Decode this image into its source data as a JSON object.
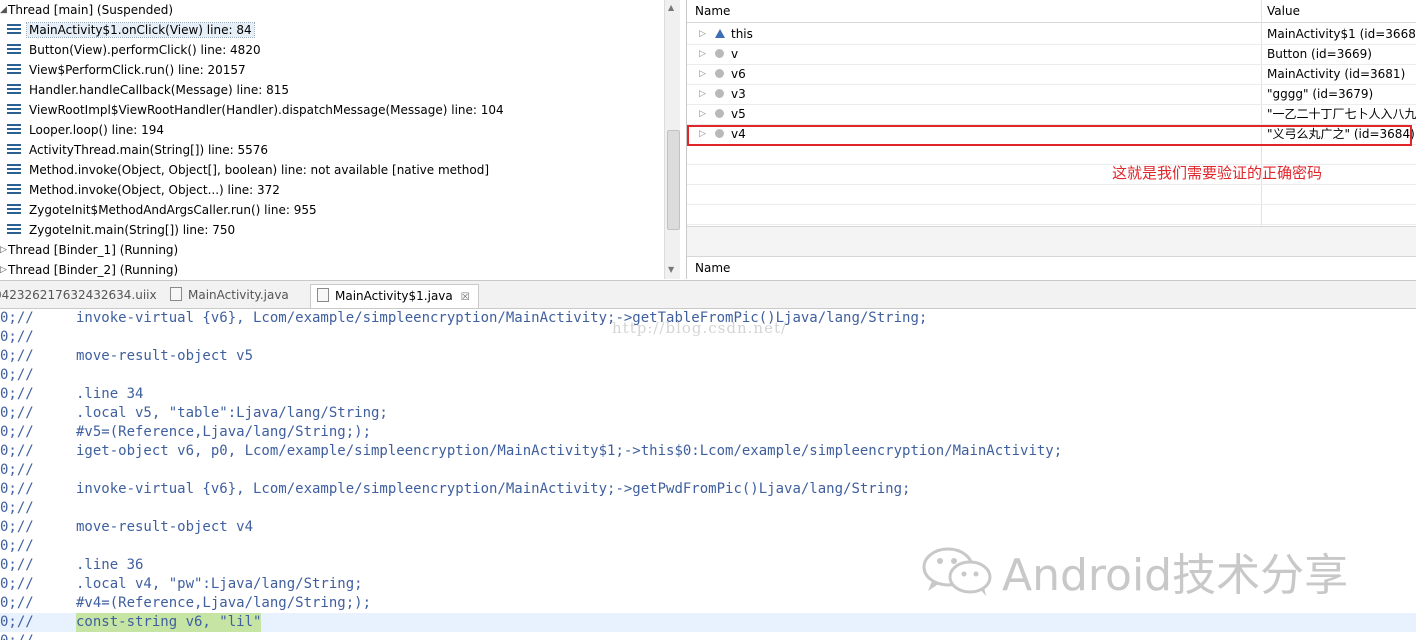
{
  "debug": {
    "threads_top": {
      "label": "Thread [main] (Suspended)"
    },
    "frames": [
      "MainActivity$1.onClick(View) line: 84",
      "Button(View).performClick() line: 4820",
      "View$PerformClick.run() line: 20157",
      "Handler.handleCallback(Message) line: 815",
      "ViewRootImpl$ViewRootHandler(Handler).dispatchMessage(Message) line: 104",
      "Looper.loop() line: 194",
      "ActivityThread.main(String[]) line: 5576",
      "Method.invoke(Object, Object[], boolean) line: not available [native method]",
      "Method.invoke(Object, Object...) line: 372",
      "ZygoteInit$MethodAndArgsCaller.run() line: 955",
      "ZygoteInit.main(String[]) line: 750"
    ],
    "threads_bottom": [
      "Thread [Binder_1] (Running)",
      "Thread [Binder_2] (Running)"
    ]
  },
  "variables": {
    "col_name": "Name",
    "col_value": "Value",
    "rows": [
      {
        "name": "this",
        "value": "MainActivity$1  (id=3668)",
        "icon": "field-triangle-icon"
      },
      {
        "name": "v",
        "value": "Button  (id=3669)",
        "icon": "local-variable-icon"
      },
      {
        "name": "v6",
        "value": "MainActivity  (id=3681)",
        "icon": "local-variable-icon"
      },
      {
        "name": "v3",
        "value": "\"gggg\" (id=3679)",
        "icon": "local-variable-icon"
      },
      {
        "name": "v5",
        "value": "\"一乙二十丁厂七卜人入八九",
        "icon": "local-variable-icon"
      },
      {
        "name": "v4",
        "value": "\"义弓么丸广之\" (id=3684)",
        "icon": "local-variable-icon"
      }
    ],
    "annotation": "这就是我们需要验证的正确密码",
    "detail_col_name": "Name",
    "highlight_color": "#e0262b"
  },
  "editor": {
    "tabs": [
      {
        "label": "042326217632432634.uiix"
      },
      {
        "label": "MainActivity.java"
      },
      {
        "label": "MainActivity$1.java",
        "close": "☒"
      }
    ],
    "line_marker": "0;//",
    "lines": [
      "invoke-virtual {v6}, Lcom/example/simpleencryption/MainActivity;->getTableFromPic()Ljava/lang/String;",
      "",
      "move-result-object v5",
      "",
      ".line 34",
      ".local v5, \"table\":Ljava/lang/String;",
      "#v5=(Reference,Ljava/lang/String;);",
      "iget-object v6, p0, Lcom/example/simpleencryption/MainActivity$1;->this$0:Lcom/example/simpleencryption/MainActivity;",
      "",
      "invoke-virtual {v6}, Lcom/example/simpleencryption/MainActivity;->getPwdFromPic()Ljava/lang/String;",
      "",
      "move-result-object v4",
      "",
      ".line 36",
      ".local v4, \"pw\":Ljava/lang/String;",
      "#v4=(Reference,Ljava/lang/String;);",
      "const-string v6, \"lil\"",
      ""
    ],
    "current_line_index": 16,
    "watermark_url": "http://blog.csdn.net/",
    "brand": "Android技术分享"
  }
}
